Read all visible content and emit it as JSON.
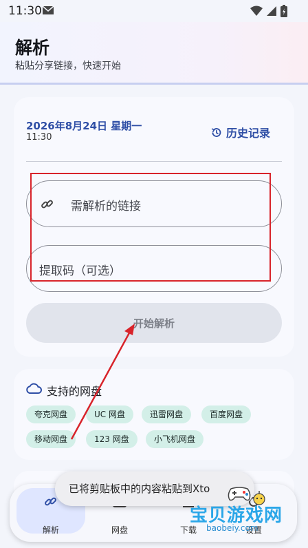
{
  "status": {
    "time": "11:30"
  },
  "header": {
    "title": "解析",
    "subtitle": "粘贴分享链接，快速开始"
  },
  "card": {
    "date": "2026年8月24日 星期一",
    "time": "11:30",
    "history_label": "历史记录",
    "link_placeholder": "需解析的链接",
    "code_placeholder": "提取码（可选）",
    "start_button": "开始解析"
  },
  "disks": {
    "title": "支持的网盘",
    "items": [
      "夸克网盘",
      "UC 网盘",
      "迅雷网盘",
      "百度网盘",
      "移动网盘",
      "123 网盘",
      "小飞机网盘"
    ]
  },
  "nav": {
    "items": [
      {
        "label": "解析"
      },
      {
        "label": "网盘"
      },
      {
        "label": "下载"
      },
      {
        "label": "设置"
      }
    ]
  },
  "toast": {
    "text": "已将剪贴板中的内容粘贴到Xto"
  },
  "watermark": {
    "text": "宝贝游戏网",
    "url": "baobeiy.com"
  },
  "colors": {
    "accent": "#2f4fa6",
    "chip": "#d3efe8",
    "annotation": "#d8232a"
  }
}
